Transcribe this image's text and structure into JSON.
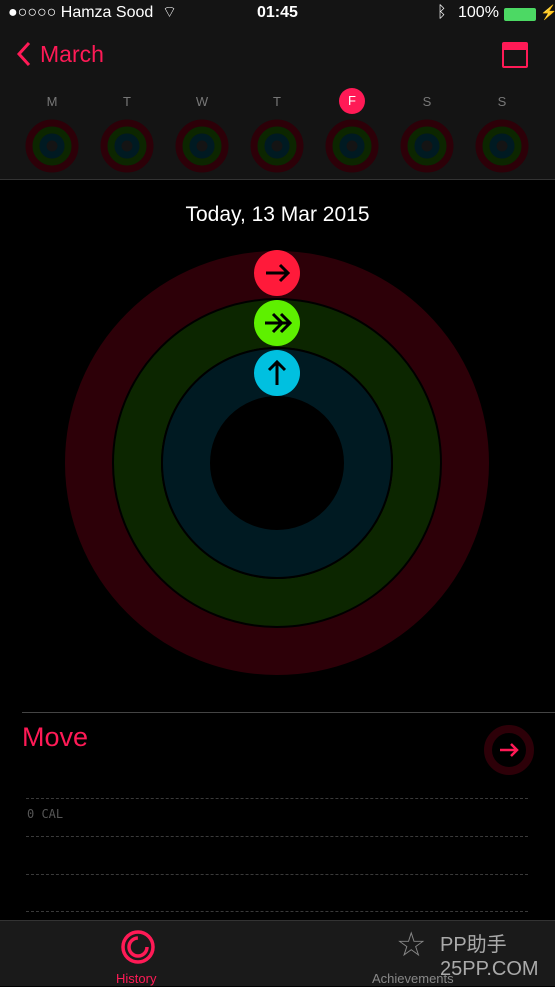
{
  "status": {
    "carrier": "●○○○○ Hamza Sood",
    "time": "01:45",
    "battery": "100%"
  },
  "nav": {
    "back_label": "March"
  },
  "week": {
    "days": [
      "M",
      "T",
      "W",
      "T",
      "F",
      "S",
      "S"
    ],
    "selected_index": 4
  },
  "summary": {
    "date": "Today, 13 Mar 2015",
    "move_progress": 0,
    "exercise_progress": 0,
    "stand_progress": 0
  },
  "colors": {
    "move": "#ff1a56",
    "exercise": "#5ef000",
    "stand": "#00c0e0"
  },
  "move": {
    "title": "Move",
    "value": "0 CAL"
  },
  "tabs": [
    {
      "label": "History",
      "active": true
    },
    {
      "label": "Achievements",
      "active": false
    }
  ],
  "watermark": "PP助手 25PP.COM"
}
